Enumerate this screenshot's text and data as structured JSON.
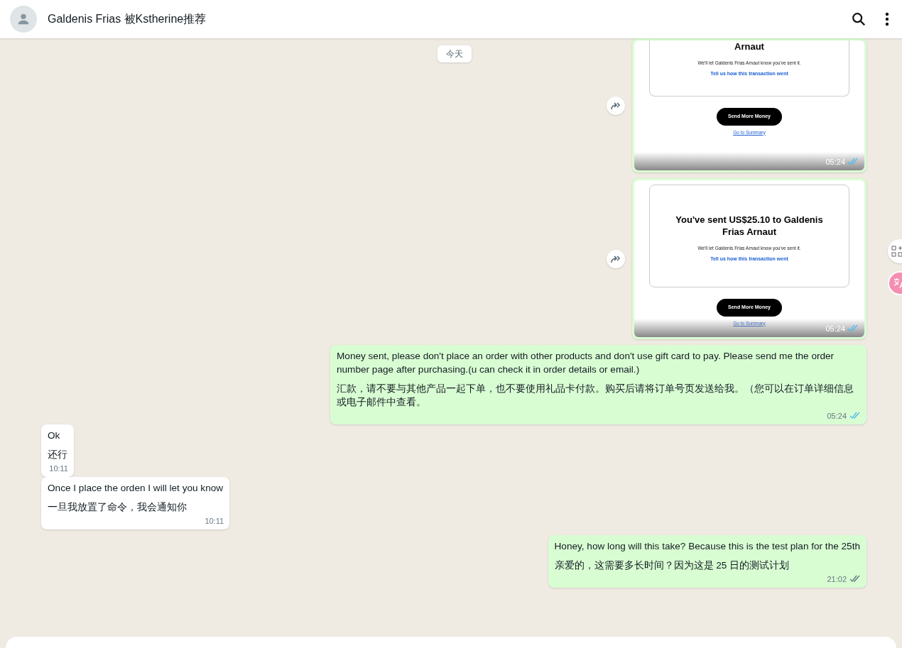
{
  "header": {
    "title": "Galdenis Frias 被Kstherine推荐"
  },
  "date_chip": "今天",
  "messages": [
    {
      "kind": "image",
      "outgoing": true,
      "time": "05:24",
      "read": true,
      "forward": true,
      "image": {
        "heading": "Arnaut",
        "note": "We'll let Galdenis Frias Arnaut know you've sent it.",
        "link": "Tell us how this transaction went",
        "button": "Send More Money",
        "summary": "Go to Summary"
      }
    },
    {
      "kind": "image",
      "outgoing": true,
      "time": "05:24",
      "read": true,
      "forward": true,
      "image": {
        "heading": "You've sent US$25.10 to Galdenis Frias Arnaut",
        "note": "We'll let Galdenis Frias Arnaut know you've sent it.",
        "link": "Tell us how this transaction went",
        "button": "Send More Money",
        "summary": "Go to Summary"
      }
    },
    {
      "kind": "text",
      "outgoing": true,
      "time": "05:24",
      "read": true,
      "lines": [
        "Money sent, please don't place an order with other products and don't use gift card to pay. Please send me the order number page after purchasing.(u can check it in order details or email.)",
        "汇款，请不要与其他产品一起下单，也不要使用礼品卡付款。购买后请将订单号页发送给我。（您可以在订单详细信息或电子邮件中查看。"
      ]
    },
    {
      "kind": "text",
      "outgoing": false,
      "time": "10:11",
      "lines": [
        "Ok",
        "还行"
      ]
    },
    {
      "kind": "text",
      "outgoing": false,
      "time": "10:11",
      "lines": [
        "Once I place the orden I will let you know",
        "一旦我放置了命令，我会通知你"
      ]
    },
    {
      "kind": "text",
      "outgoing": true,
      "time": "21:02",
      "read": false,
      "lines": [
        "Honey, how long will this take? Because this is the test plan for the 25th",
        "亲爱的，这需要多长时间？因为这是 25 日的测试计划"
      ]
    }
  ]
}
